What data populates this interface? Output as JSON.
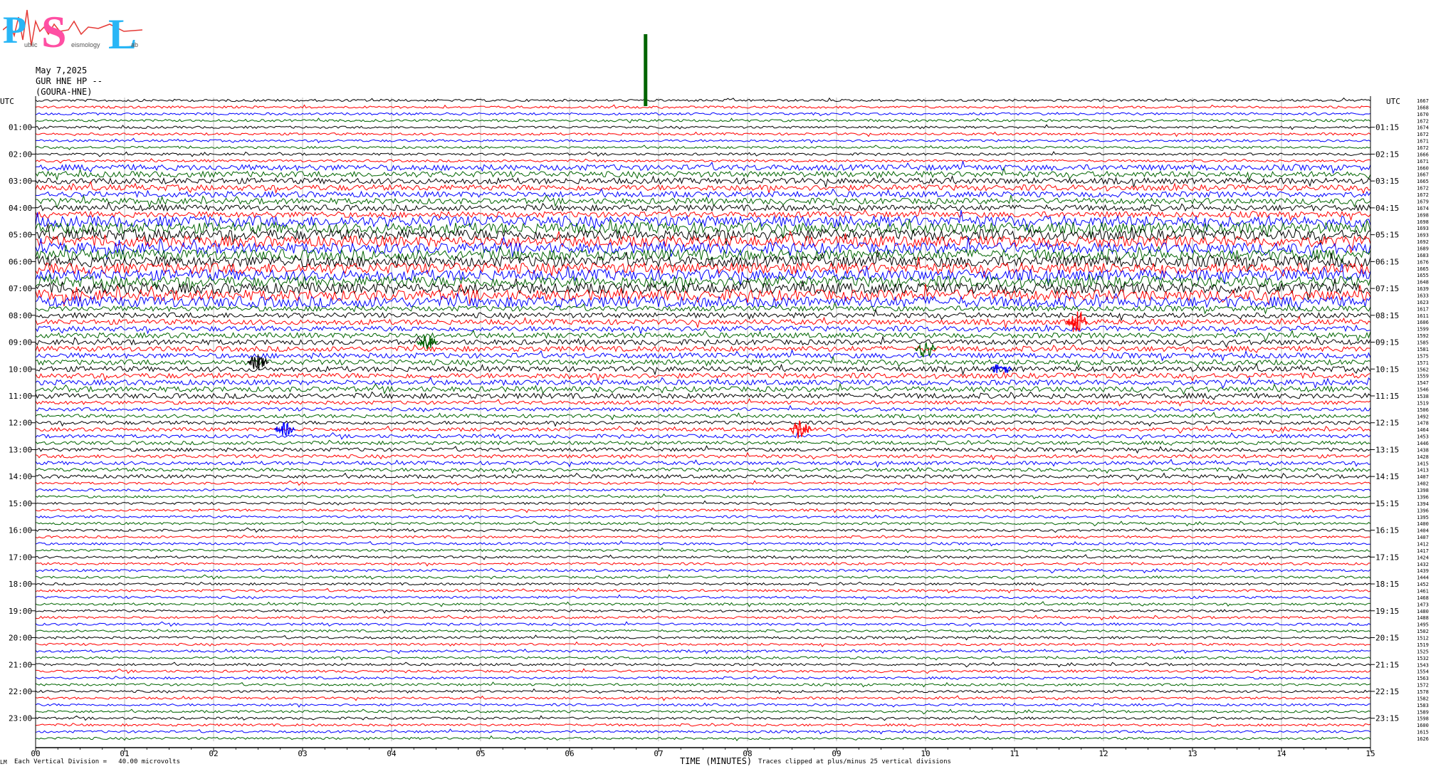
{
  "logo": {
    "letters": [
      "P",
      "S",
      "L"
    ],
    "small_text": [
      "ublic",
      "eismology",
      "ab"
    ],
    "colors": {
      "main": "#29b6f6",
      "pink": "#ff4fa3",
      "wave": "#e53935"
    }
  },
  "header": {
    "date": "May 7,2025",
    "station": "GUR HNE HP --",
    "name": "(GOURA-HNE)"
  },
  "chart_data": {
    "type": "line",
    "subtype": "helicorder",
    "x": [
      0,
      15
    ],
    "xlim": [
      0,
      15
    ],
    "x_ticks": [
      "00",
      "01",
      "02",
      "03",
      "04",
      "05",
      "06",
      "07",
      "08",
      "09",
      "10",
      "11",
      "12",
      "13",
      "14",
      "15"
    ],
    "xlabel": "TIME (MINUTES)",
    "left_axis_title": "UTC",
    "right_axis_title": "UTC",
    "left_hour_labels": [
      "01:00",
      "02:00",
      "03:00",
      "04:00",
      "05:00",
      "06:00",
      "07:00",
      "08:00",
      "09:00",
      "10:00",
      "11:00",
      "12:00",
      "13:00",
      "14:00",
      "15:00",
      "16:00",
      "17:00",
      "18:00",
      "19:00",
      "20:00",
      "21:00",
      "22:00",
      "23:00"
    ],
    "right_hour_labels": [
      "01:15",
      "02:15",
      "03:15",
      "04:15",
      "05:15",
      "06:15",
      "07:15",
      "08:15",
      "09:15",
      "10:15",
      "11:15",
      "12:15",
      "13:15",
      "14:15",
      "15:15",
      "16:15",
      "17:15",
      "18:15",
      "19:15",
      "20:15",
      "21:15",
      "22:15",
      "23:15"
    ],
    "trace_count": 96,
    "trace_colors": [
      "#000000",
      "#ff0000",
      "#0000ff",
      "#006400"
    ],
    "trace_offsets": [
      1667,
      1668,
      1670,
      1672,
      1674,
      1672,
      1671,
      1672,
      1666,
      1671,
      1660,
      1667,
      1665,
      1672,
      1672,
      1679,
      1674,
      1698,
      1698,
      1693,
      1693,
      1692,
      1689,
      1683,
      1676,
      1665,
      1655,
      1648,
      1639,
      1633,
      1623,
      1617,
      1611,
      1606,
      1599,
      1592,
      1585,
      1581,
      1575,
      1571,
      1562,
      1559,
      1547,
      1546,
      1538,
      1519,
      1506,
      1492,
      1478,
      1464,
      1453,
      1446,
      1438,
      1428,
      1415,
      1413,
      1407,
      1402,
      1398,
      1396,
      1394,
      1396,
      1395,
      1400,
      1404,
      1407,
      1412,
      1417,
      1424,
      1432,
      1439,
      1444,
      1452,
      1461,
      1468,
      1473,
      1480,
      1488,
      1495,
      1502,
      1512,
      1519,
      1525,
      1532,
      1543,
      1554,
      1563,
      1572,
      1578,
      1582,
      1583,
      1589,
      1598,
      1600,
      1615,
      1626
    ],
    "footer_left": "Each Vertical Division =   40.00 microvolts",
    "footer_right": "Traces clipped at plus/minus 25 vertical divisions",
    "footer_mark": "LM",
    "events": [
      {
        "minute": 6.85,
        "trace": 0,
        "amplitude": 70,
        "color": "#006400",
        "label": ""
      },
      {
        "minute": 11.7,
        "trace": 33,
        "amplitude": 20,
        "color": "#ff0000"
      },
      {
        "minute": 8.6,
        "trace": 49,
        "amplitude": 14,
        "color": "#ff0000"
      },
      {
        "minute": 2.8,
        "trace": 49,
        "amplitude": 10,
        "color": "#0000ff"
      },
      {
        "minute": 10.0,
        "trace": 37,
        "amplitude": 12,
        "color": "#006400"
      },
      {
        "minute": 4.4,
        "trace": 36,
        "amplitude": 10,
        "color": "#006400"
      },
      {
        "minute": 2.5,
        "trace": 39,
        "amplitude": 12,
        "color": "#000000"
      },
      {
        "minute": 10.85,
        "trace": 40,
        "amplitude": 10,
        "color": "#0000ff"
      }
    ]
  }
}
